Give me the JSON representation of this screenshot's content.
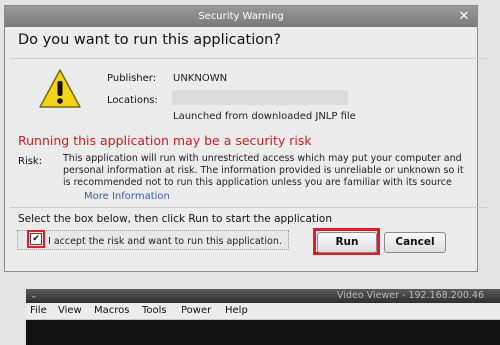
{
  "dialog": {
    "title": "Security Warning",
    "close_icon": "close-icon",
    "heading": "Do you want to run this application?",
    "publisher_label": "Publisher:",
    "publisher_value": "UNKNOWN",
    "locations_label": "Locations:",
    "locations_note": "Launched from downloaded JNLP file",
    "warning_icon": "warning-triangle-icon",
    "risk_title": "Running this application may be a security risk",
    "risk_label": "Risk:",
    "risk_text": "This application will run with unrestricted access which may put your computer and personal information at risk. The information provided is unreliable or unknown so it is recommended not to run this application unless you are familiar with its source",
    "more_info": "More Information",
    "select_instruction": "Select the box below, then click Run to start the application",
    "accept_label": "I accept the risk and want to run this application.",
    "accept_checked": true,
    "run_label": "Run",
    "cancel_label": "Cancel"
  },
  "background_window": {
    "title": "Video Viewer - 192.168.200.46",
    "menu": [
      "File",
      "View",
      "Macros",
      "Tools",
      "Power",
      "Help"
    ]
  },
  "colors": {
    "risk_red": "#c62020",
    "highlight_red": "#e01b24",
    "link_blue": "#3a5ea8"
  }
}
